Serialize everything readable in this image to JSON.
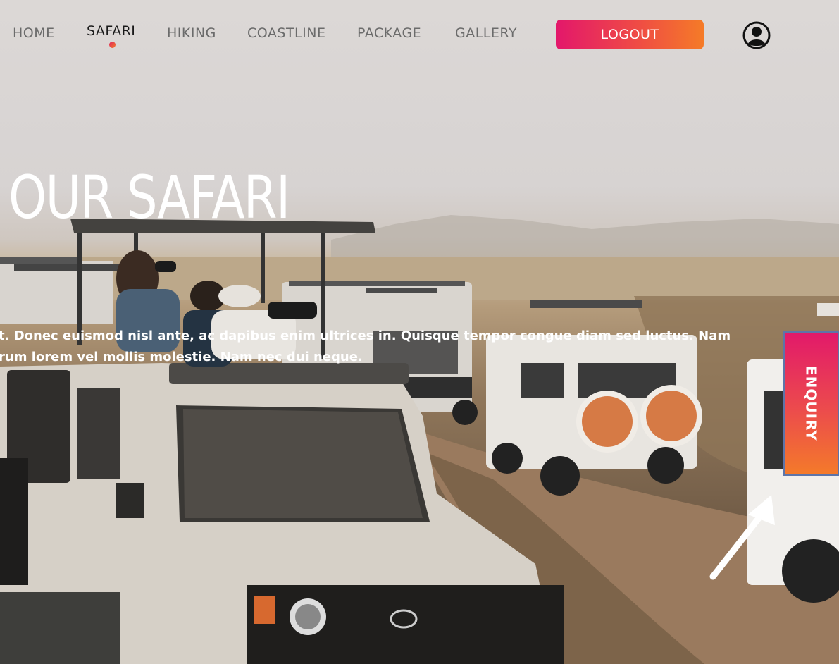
{
  "nav": {
    "items": [
      {
        "label": "HOME",
        "active": false
      },
      {
        "label": "SAFARI",
        "active": true
      },
      {
        "label": "HIKING",
        "active": false
      },
      {
        "label": "COASTLINE",
        "active": false
      },
      {
        "label": "PACKAGE",
        "active": false
      },
      {
        "label": "GALLERY",
        "active": false
      }
    ],
    "logout_label": "LOGOUT",
    "user_icon": "user-circle-icon"
  },
  "hero": {
    "title": "OUR SAFARI",
    "description_line1": "t. Donec euismod nisl ante, ac dapibus enim ultrices in. Quisque tempor congue diam sed luctus. Nam",
    "description_line2": "rum lorem vel mollis molestie. Nam nec dui neque."
  },
  "enquiry": {
    "label": "ENQUIRY"
  },
  "colors": {
    "accent_start": "#e3176b",
    "accent_end": "#f57b27"
  }
}
